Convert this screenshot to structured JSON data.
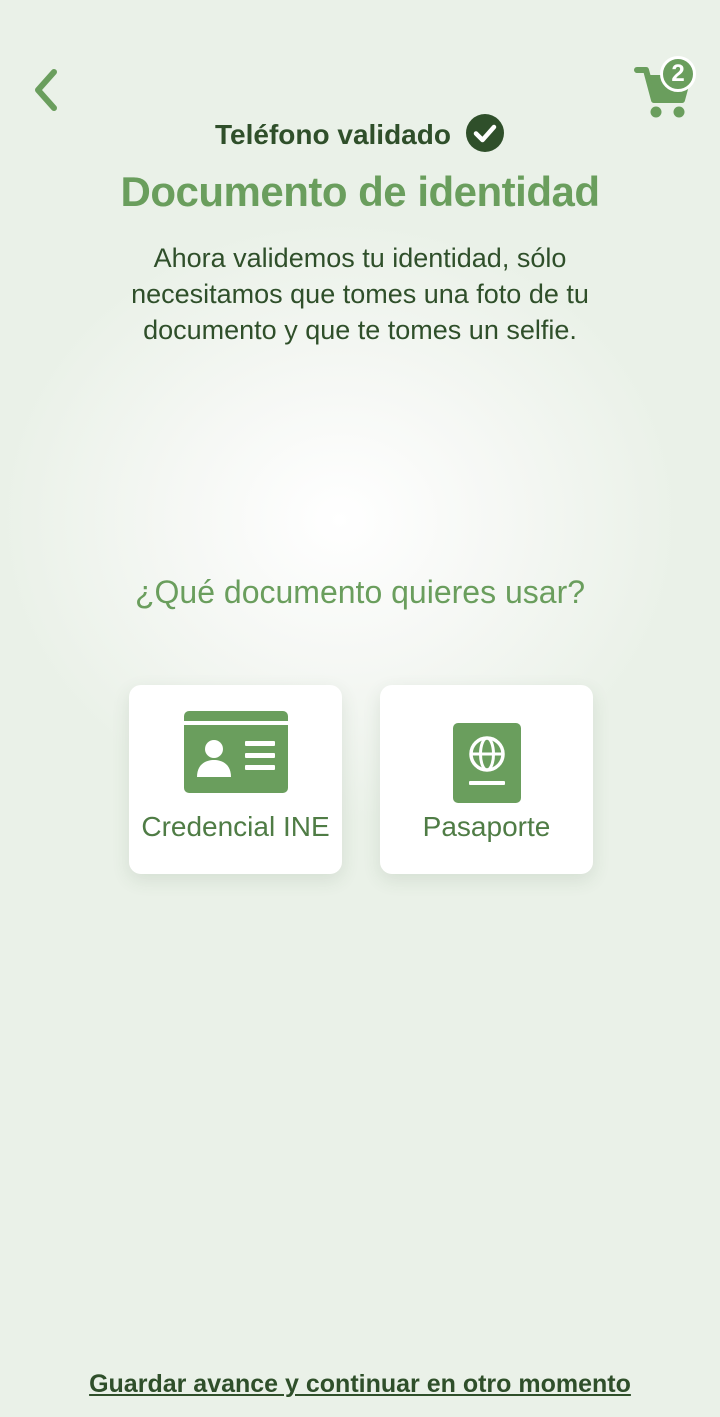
{
  "header": {
    "back_icon": "chevron-left-icon",
    "cart_icon": "shopping-cart-icon",
    "cart_count": "2"
  },
  "status": {
    "label": "Teléfono validado",
    "icon": "check-circle-icon"
  },
  "title": "Documento de identidad",
  "description": "Ahora validemos tu identidad, sólo necesitamos que tomes una foto de tu documento y que te tomes un selfie.",
  "question": "¿Qué documento quieres usar?",
  "options": [
    {
      "label": "Credencial INE",
      "icon": "id-card-icon"
    },
    {
      "label": "Pasaporte",
      "icon": "passport-icon"
    }
  ],
  "footer": {
    "save_link": "Guardar avance y continuar en otro momento"
  },
  "colors": {
    "accent": "#6a9e5d",
    "text_dark": "#2f4f2a",
    "card_label": "#4f7c45",
    "background": "#eef3ec"
  }
}
